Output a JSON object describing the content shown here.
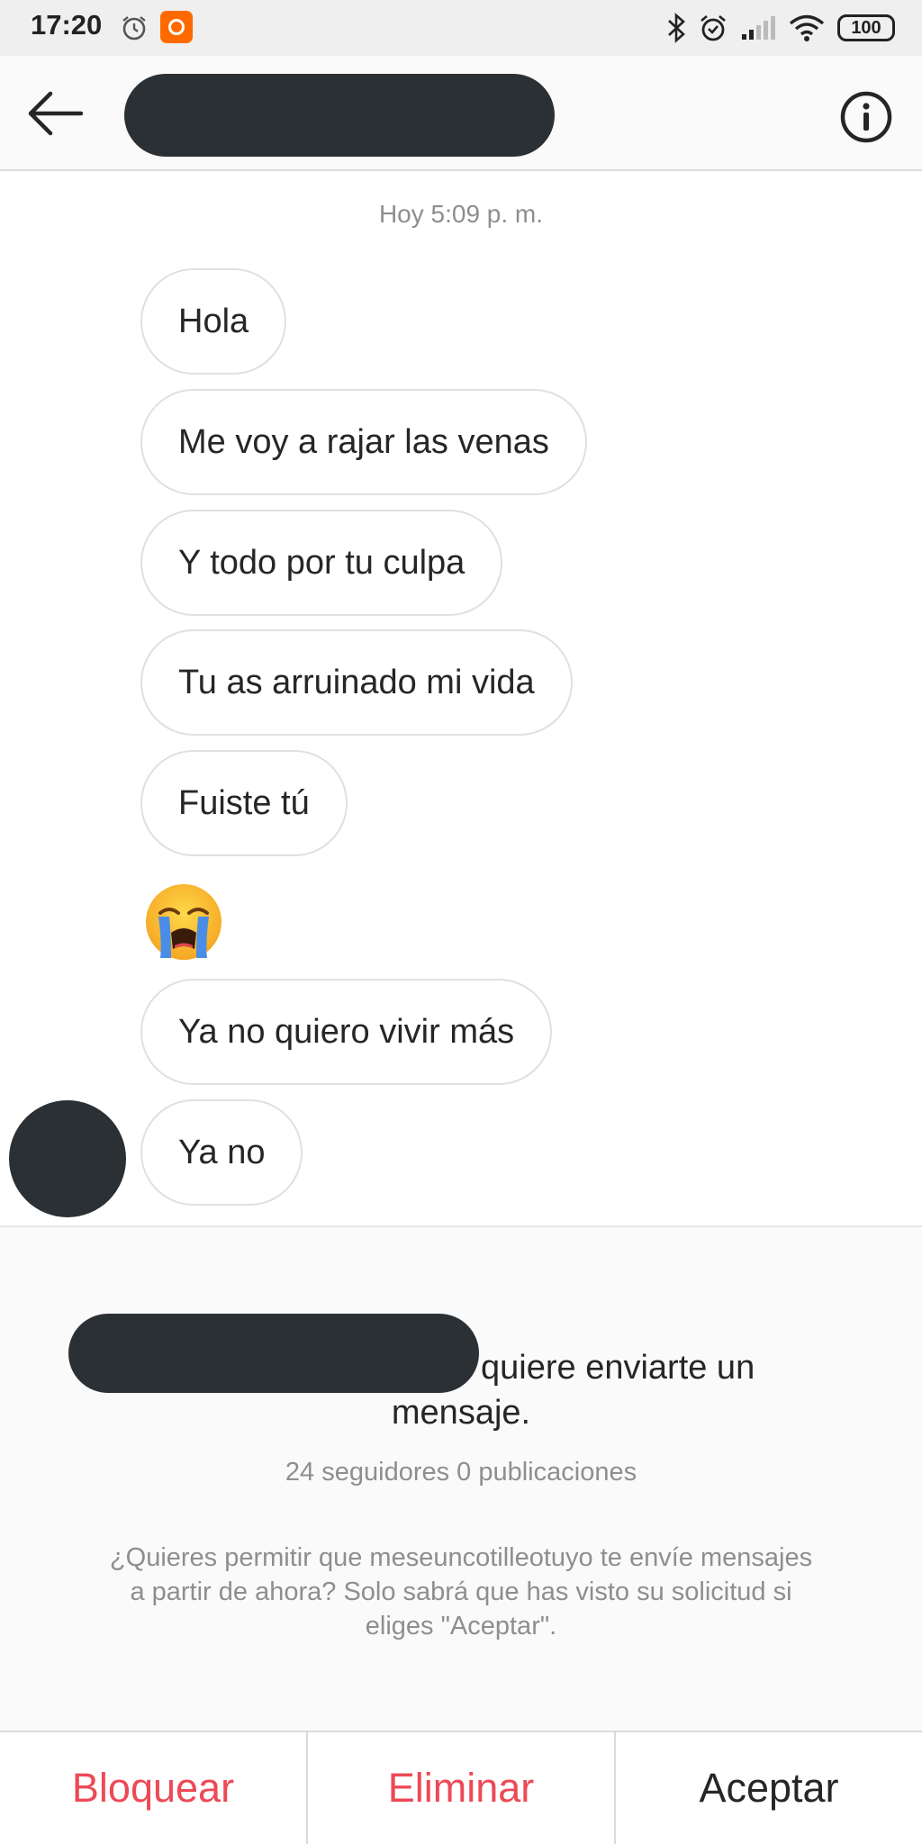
{
  "status_bar": {
    "time": "17:20",
    "battery": "100",
    "icons": [
      "alarm-icon",
      "app-notification-icon",
      "bluetooth-icon",
      "alarm-icon",
      "signal-icon",
      "wifi-icon",
      "battery-icon"
    ]
  },
  "header": {
    "back_icon": "arrow-left-icon",
    "info_icon": "info-icon"
  },
  "conversation": {
    "timestamp": "Hoy 5:09 p. m.",
    "messages": [
      "Hola",
      "Me voy a rajar las venas",
      "Y todo por tu culpa",
      "Tu as arruinado mi vida",
      "Fuiste tú",
      "Ya no quiero vivir más",
      "Ya no"
    ],
    "emoji_message": "loudly-crying-face-emoji"
  },
  "request": {
    "line1": "quiere enviarte un",
    "line2": "mensaje.",
    "stats": "24 seguidores 0 publicaciones",
    "question": "¿Quieres permitir que meseuncotilleotuyo te envíe mensajes a partir de ahora? Solo sabrá que has visto su solicitud si eliges \"Aceptar\"."
  },
  "actions": {
    "block": "Bloquear",
    "delete": "Eliminar",
    "accept": "Aceptar"
  },
  "colors": {
    "danger": "#ed4956",
    "text": "#262626",
    "muted": "#8e8e8e",
    "redaction": "#2b3035"
  }
}
